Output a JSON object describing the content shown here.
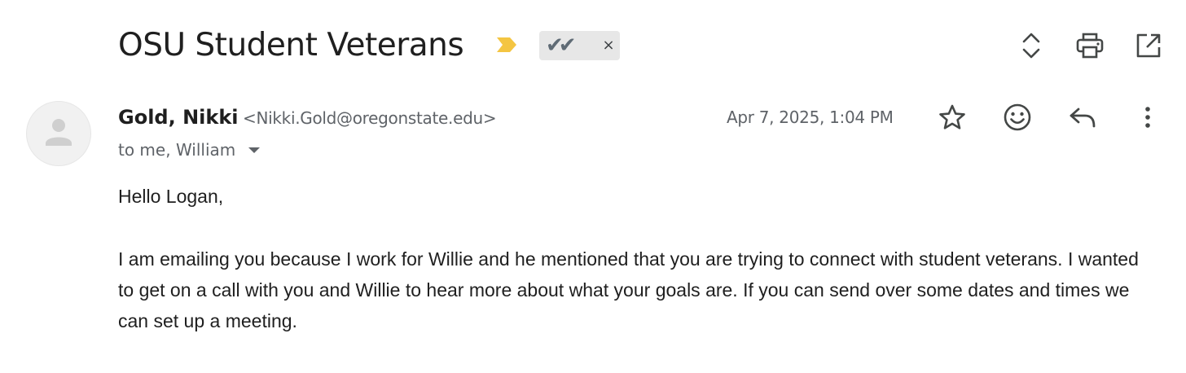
{
  "email": {
    "subject": "OSU Student Veterans",
    "label": {
      "text": "✔✔",
      "remove": "×"
    },
    "sender": {
      "name": "Gold, Nikki",
      "email": "<Nikki.Gold@oregonstate.edu>"
    },
    "recipients": "to me, William",
    "timestamp": "Apr 7, 2025, 1:04 PM",
    "body": {
      "greeting": "Hello Logan,",
      "paragraph": "I am emailing you because I work for Willie and he mentioned that you are trying to connect with student veterans. I wanted to get on a call with you and Willie to hear more about what your goals are. If you can send over some dates and times we can set up a meeting."
    }
  },
  "icons": {
    "importance": "importance-marker-icon",
    "expand": "expand-collapse-icon",
    "print": "print-icon",
    "open_new_window": "open-in-new-window-icon",
    "star": "star-icon",
    "emoji": "emoji-reaction-icon",
    "reply": "reply-icon",
    "more": "more-vert-icon",
    "avatar": "person-icon"
  },
  "colors": {
    "importance": "#f4c542",
    "label_bg": "#e7e7e7",
    "label_check": "#5f6b75",
    "secondary_text": "#5f6368",
    "primary_text": "#1f1f1f",
    "icon": "#444746"
  }
}
